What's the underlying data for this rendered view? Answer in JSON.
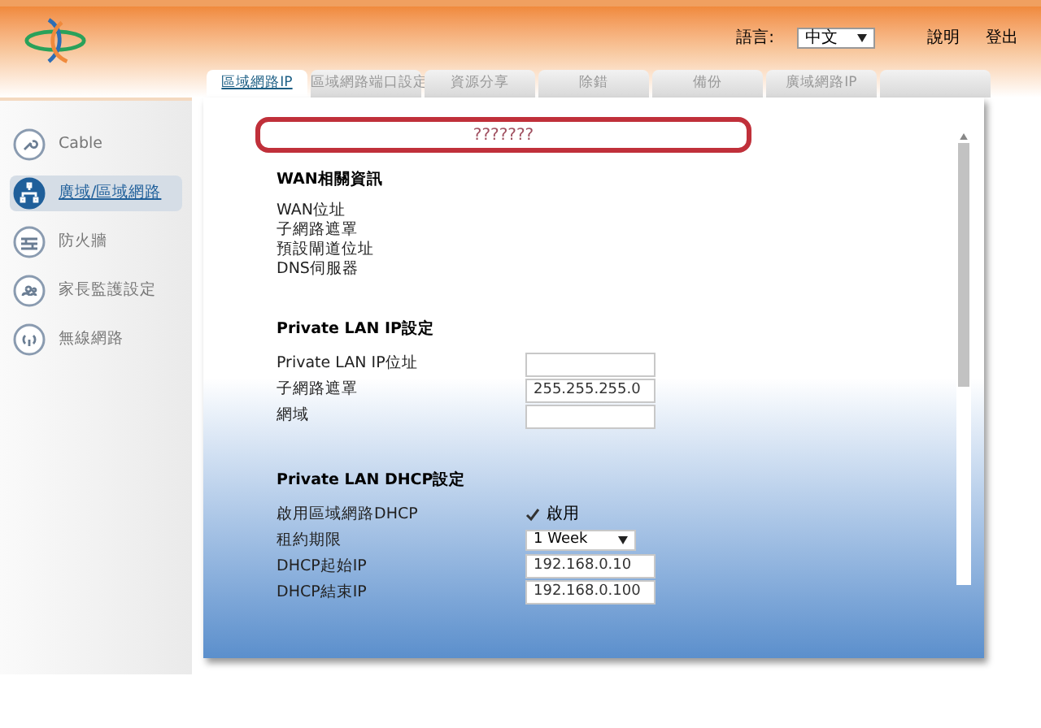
{
  "header": {
    "language_label": "語言:",
    "language": "中文",
    "links": [
      "說明",
      "登出"
    ]
  },
  "tabs": [
    {
      "label": "區域網路IP",
      "selected": true
    },
    {
      "label": "區域網路端口設定",
      "selected": false
    },
    {
      "label": "資源分享",
      "selected": false
    },
    {
      "label": "除錯",
      "selected": false
    },
    {
      "label": "備份",
      "selected": false
    },
    {
      "label": "廣域網路IP",
      "selected": false
    },
    {
      "selected": false
    }
  ],
  "sidebar": {
    "items": [
      {
        "label": "Cable",
        "selected": false
      },
      {
        "label": "廣域/區域網路",
        "selected": true
      },
      {
        "label": "防火牆",
        "selected": false
      },
      {
        "label": "家長監護設定",
        "selected": false
      },
      {
        "label": "無線網路",
        "selected": false
      }
    ]
  },
  "banner": "???????",
  "sections": [
    {
      "title": "WAN相關資訊",
      "rows": [
        {
          "label": "WAN位址",
          "kind": "text"
        },
        {
          "label": "子網路遮罩",
          "kind": "text"
        },
        {
          "label": "預設閘道位址",
          "kind": "text"
        },
        {
          "label": "DNS伺服器",
          "kind": "text"
        }
      ]
    },
    {
      "title": "Private LAN IP設定",
      "rows": [
        {
          "label": "Private LAN IP位址",
          "kind": "input"
        },
        {
          "label": "子網路遮罩",
          "kind": "input",
          "value": "255.255.255.0"
        },
        {
          "label": "網域",
          "kind": "input"
        }
      ]
    },
    {
      "title": "Private LAN DHCP設定",
      "rows": [
        {
          "label": "啟用區域網路DHCP",
          "kind": "checkbox",
          "checked": true,
          "value": "啟用"
        },
        {
          "label": "租約期限",
          "kind": "select",
          "value": "1 Week"
        },
        {
          "label": "DHCP起始IP",
          "kind": "input",
          "value": "192.168.0.10"
        },
        {
          "label": "DHCP結束IP",
          "kind": "input",
          "value": "192.168.0.100"
        }
      ]
    }
  ]
}
